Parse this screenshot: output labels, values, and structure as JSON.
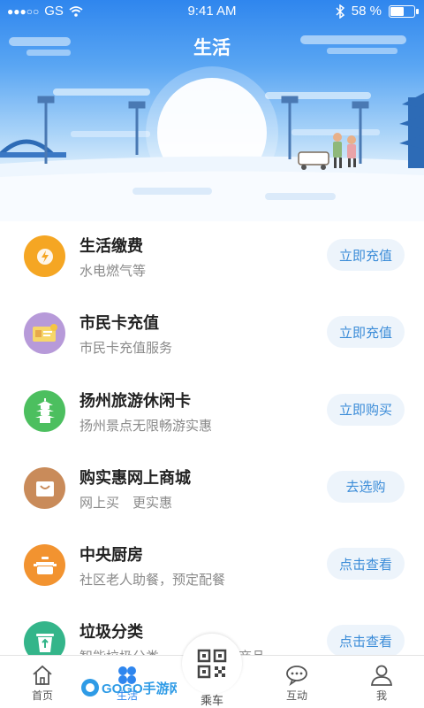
{
  "status_bar": {
    "carrier": "GS",
    "time": "9:41 AM",
    "battery": "58 %",
    "battery_level": 0.58
  },
  "header": {
    "title": "生活"
  },
  "services": [
    {
      "title": "生活缴费",
      "subtitle": "水电燃气等",
      "button": "立即充值",
      "icon": "lightning-icon",
      "color": "#f5a623"
    },
    {
      "title": "市民卡充值",
      "subtitle": "市民卡充值服务",
      "button": "立即充值",
      "icon": "card-icon",
      "color": "#b79ad9"
    },
    {
      "title": "扬州旅游休闲卡",
      "subtitle": "扬州景点无限畅游实惠",
      "button": "立即购买",
      "icon": "pagoda-icon",
      "color": "#4cbf5f"
    },
    {
      "title": "购实惠网上商城",
      "subtitle": "网上买　更实惠",
      "button": "去选购",
      "icon": "shopping-bag-icon",
      "color": "#c98b5a"
    },
    {
      "title": "中央厨房",
      "subtitle": "社区老人助餐，预定配餐",
      "button": "点击查看",
      "icon": "cooking-pot-icon",
      "color": "#f29330"
    },
    {
      "title": "垃圾分类",
      "subtitle": "智能垃圾分类　　积分兑换商品",
      "button": "点击查看",
      "icon": "recycle-bin-icon",
      "color": "#34b58a"
    }
  ],
  "tabbar": {
    "home": "首页",
    "life": "生活",
    "ride": "乘车",
    "interact": "互动",
    "me": "我"
  },
  "watermark": {
    "text": "GOGO手游网"
  }
}
